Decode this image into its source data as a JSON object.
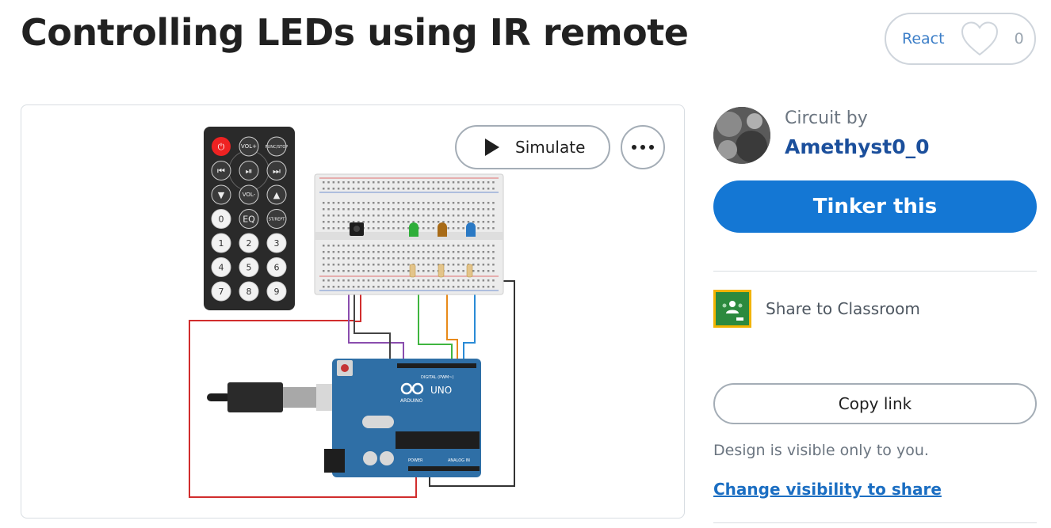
{
  "project": {
    "title": "Controlling LEDs using IR remote"
  },
  "react": {
    "label": "React",
    "count": "0"
  },
  "canvas": {
    "simulate_label": "Simulate",
    "more_icon": "more-horizontal-icon",
    "remote_buttons": [
      "⏻",
      "VOL+",
      "FUNC/STOP",
      "⏮",
      "⏯",
      "⏭",
      "▼",
      "VOL-",
      "▲",
      "0",
      "EQ",
      "ST/REPT",
      "1",
      "2",
      "3",
      "4",
      "5",
      "6",
      "7",
      "8",
      "9"
    ],
    "board_labels": {
      "brand": "ARDUINO",
      "model": "UNO",
      "digital": "DIGITAL (PWM~)",
      "power": "POWER",
      "analog": "ANALOG IN"
    }
  },
  "sidebar": {
    "circuit_by": "Circuit by",
    "author": "Amethyst0_0",
    "tinker_label": "Tinker this",
    "classroom_label": "Share to Classroom",
    "copy_label": "Copy link",
    "visibility_text": "Design is visible only to you.",
    "change_visibility_label": "Change visibility to share"
  },
  "colors": {
    "primary": "#1477d4",
    "author": "#1b4f9c",
    "link": "#1b6ec2",
    "board": "#2f6fa6"
  }
}
